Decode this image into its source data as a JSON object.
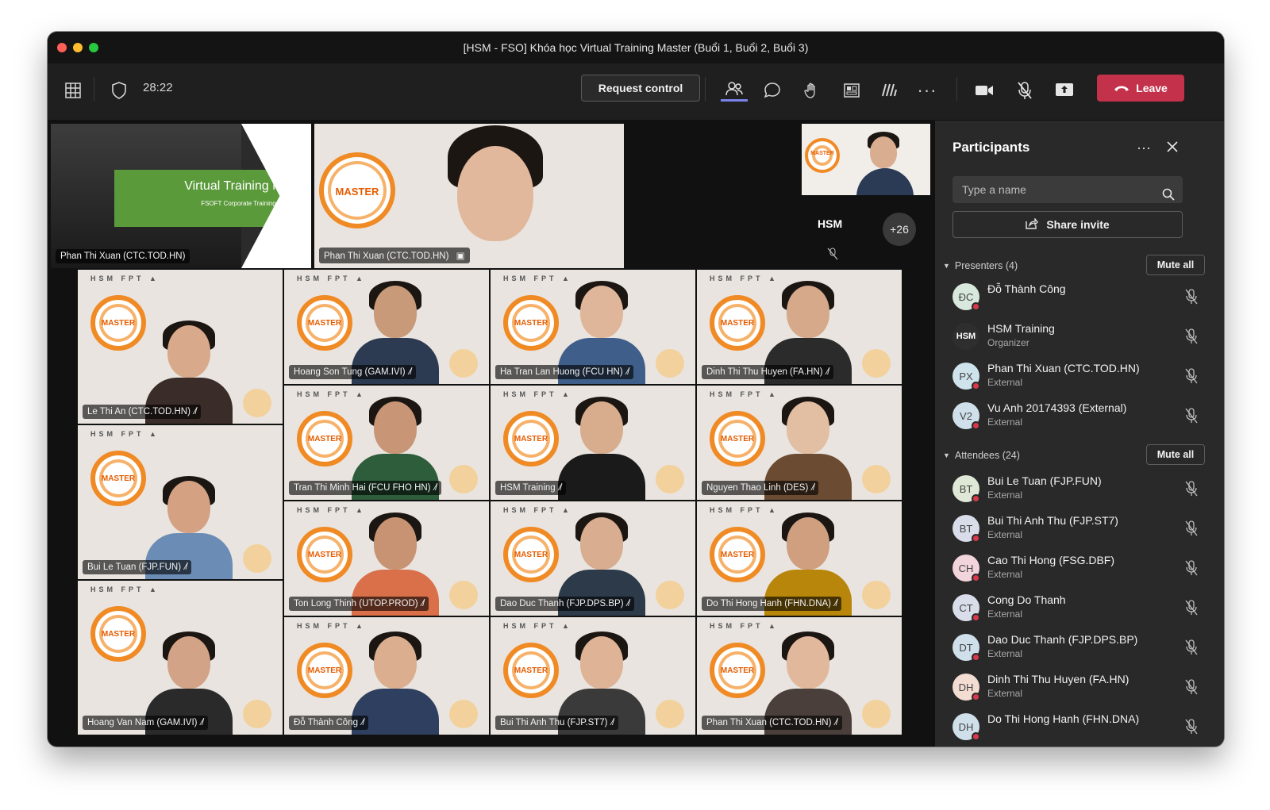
{
  "window": {
    "title": "[HSM - FSO] Khóa học Virtual Training Master (Buổi 1, Buổi 2, Buổi 3)"
  },
  "toolbar": {
    "timer": "28:22",
    "request_control": "Request control",
    "leave": "Leave"
  },
  "stage": {
    "top_tiles": [
      {
        "label": "Phan Thi Xuan (CTC.TOD.HN)",
        "slide_title": "Virtual Training Master",
        "slide_subtitle": "FSOFT Corporate Training Center"
      },
      {
        "label": "Phan Thi Xuan (CTC.TOD.HN)"
      }
    ],
    "overflow_count": "+26",
    "hsm_tile": "HSM",
    "grid": [
      {
        "label": "Le Thi An (CTC.TOD.HN)"
      },
      {
        "label": "Hoang Son Tung (GAM.IVI)"
      },
      {
        "label": "Ha Tran Lan Huong (FCU HN)"
      },
      {
        "label": "Dinh Thi Thu Huyen (FA.HN)"
      },
      {
        "label": "Tran Thi Minh Hai (FCU FHO HN)"
      },
      {
        "label": "HSM Training"
      },
      {
        "label": "Nguyen Thao Linh (DES)"
      },
      {
        "label": "Bui Le Tuan (FJP.FUN)"
      },
      {
        "label": "Ton Long Thinh (UTOP.PROD)"
      },
      {
        "label": "Dao Duc Thanh (FJP.DPS.BP)"
      },
      {
        "label": "Do Thi Hong Hanh (FHN.DNA)"
      },
      {
        "label": "Hoang Van Nam (GAM.IVI)"
      },
      {
        "label": "Đỗ Thành Công"
      },
      {
        "label": "Bui Thi Anh Thu (FJP.ST7)"
      },
      {
        "label": "Phan Thi Xuan (CTC.TOD.HN)"
      }
    ]
  },
  "panel": {
    "title": "Participants",
    "search_placeholder": "Type a name",
    "share_invite": "Share invite",
    "presenters_header": "Presenters (4)",
    "attendees_header": "Attendees (24)",
    "mute_all": "Mute all",
    "presenters": [
      {
        "initials": "ĐC",
        "name": "Đỗ Thành Công",
        "role": "",
        "color": "#d8e8dc"
      },
      {
        "initials": "HSM",
        "name": "HSM Training",
        "role": "Organizer",
        "color": "#2e2e2e"
      },
      {
        "initials": "PX",
        "name": "Phan Thi Xuan (CTC.TOD.HN)",
        "role": "External",
        "color": "#cfe3ec"
      },
      {
        "initials": "V2",
        "name": "Vu Anh 20174393 (External)",
        "role": "External",
        "color": "#cfe0ea"
      }
    ],
    "attendees": [
      {
        "initials": "BT",
        "name": "Bui Le Tuan (FJP.FUN)",
        "role": "External",
        "color": "#dfe8d6"
      },
      {
        "initials": "BT",
        "name": "Bui Thi Anh Thu (FJP.ST7)",
        "role": "External",
        "color": "#d9dde9"
      },
      {
        "initials": "CH",
        "name": "Cao Thi Hong (FSG.DBF)",
        "role": "External",
        "color": "#f1d4dc"
      },
      {
        "initials": "CT",
        "name": "Cong Do Thanh",
        "role": "External",
        "color": "#d9dde9"
      },
      {
        "initials": "DT",
        "name": "Dao Duc Thanh (FJP.DPS.BP)",
        "role": "External",
        "color": "#cfe0ea"
      },
      {
        "initials": "DH",
        "name": "Dinh Thi Thu Huyen (FA.HN)",
        "role": "External",
        "color": "#f3dcd2"
      },
      {
        "initials": "DH",
        "name": "Do Thi Hong Hanh (FHN.DNA)",
        "role": "",
        "color": "#cfe0ea"
      }
    ]
  },
  "colors": {
    "leave": "#c4314b",
    "accent": "#7b83eb",
    "status_red": "#d7394c"
  },
  "icons": [
    "grid-icon",
    "shield-icon",
    "participants-icon",
    "chat-icon",
    "raise-hand-icon",
    "rooms-icon",
    "whiteboard-icon",
    "more-icon",
    "camera-icon",
    "mic-off-icon",
    "share-screen-icon",
    "phone-icon",
    "search-icon",
    "close-icon"
  ]
}
